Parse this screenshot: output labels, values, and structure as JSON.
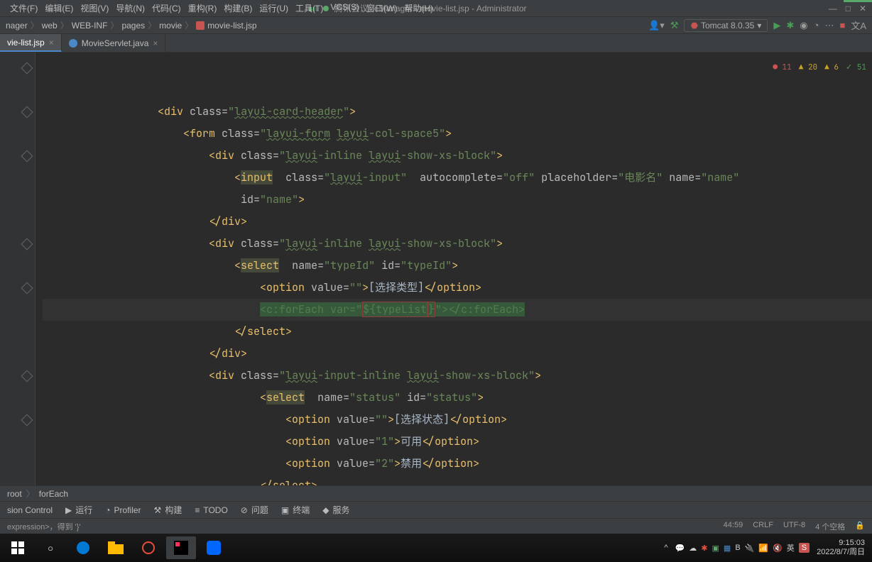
{
  "window": {
    "title_app": "腾讯会议",
    "title_suffix": "eManager - movie-list.jsp - Administrator"
  },
  "menu": {
    "file": "文件(F)",
    "edit": "编辑(E)",
    "view": "视图(V)",
    "navigate": "导航(N)",
    "code": "代码(C)",
    "refactor": "重构(R)",
    "build": "构建(B)",
    "run": "运行(U)",
    "tools": "工具(T)",
    "vcs": "VCS(S)",
    "window": "窗口(W)",
    "help": "帮助(H)"
  },
  "breadcrumb": {
    "items": [
      "nager",
      "web",
      "WEB-INF",
      "pages",
      "movie",
      "movie-list.jsp"
    ],
    "run_config": "Tomcat 8.0.35"
  },
  "tabs": [
    {
      "name": "vie-list.jsp",
      "active": true,
      "type": "jsp"
    },
    {
      "name": "MovieServlet.java",
      "active": false,
      "type": "java"
    }
  ],
  "inspection": {
    "errors": "11",
    "warnings": "20",
    "weak": "6",
    "typos": "51"
  },
  "code_lines": {
    "l1_class": "layui-card-header",
    "l2_class": "layui-form layui-col-space5",
    "l3_class": "layui-inline layui-show-xs-block",
    "l4_tag": "input",
    "l4_class": "layui-input",
    "l4_autocomplete": "off",
    "l4_placeholder": "电影名",
    "l4_name": "name",
    "l5_id": "name",
    "l7_class": "layui-inline layui-show-xs-block",
    "l8_tag": "select",
    "l8_name": "typeId",
    "l8_id": "typeId",
    "l9_value": "",
    "l9_text": "[选择类型]",
    "l10_tag": "c:forEach",
    "l10_var": "${typeList}",
    "l13_class": "layui-input-inline layui-show-xs-block",
    "l14_tag": "select",
    "l14_name": "status",
    "l14_id": "status",
    "l15_value": "",
    "l15_text": "[选择状态]",
    "l16_value": "1",
    "l16_text": "可用",
    "l17_value": "2",
    "l17_text": "禁用"
  },
  "structure_crumb": {
    "root": "root",
    "leaf": "forEach"
  },
  "bottom_tools": {
    "version_control": "sion Control",
    "run": "运行",
    "profiler": "Profiler",
    "build": "构建",
    "todo": "TODO",
    "problems": "问题",
    "terminal": "终端",
    "services": "服务"
  },
  "statusbar": {
    "left": "expression>，得到 '}'",
    "pos": "44:59",
    "line_sep": "CRLF",
    "encoding": "UTF-8",
    "indent": "4 个空格"
  },
  "taskbar": {
    "time": "9:15:03",
    "date": "2022/8/7/周日",
    "lang": "英",
    "ime": "S"
  }
}
